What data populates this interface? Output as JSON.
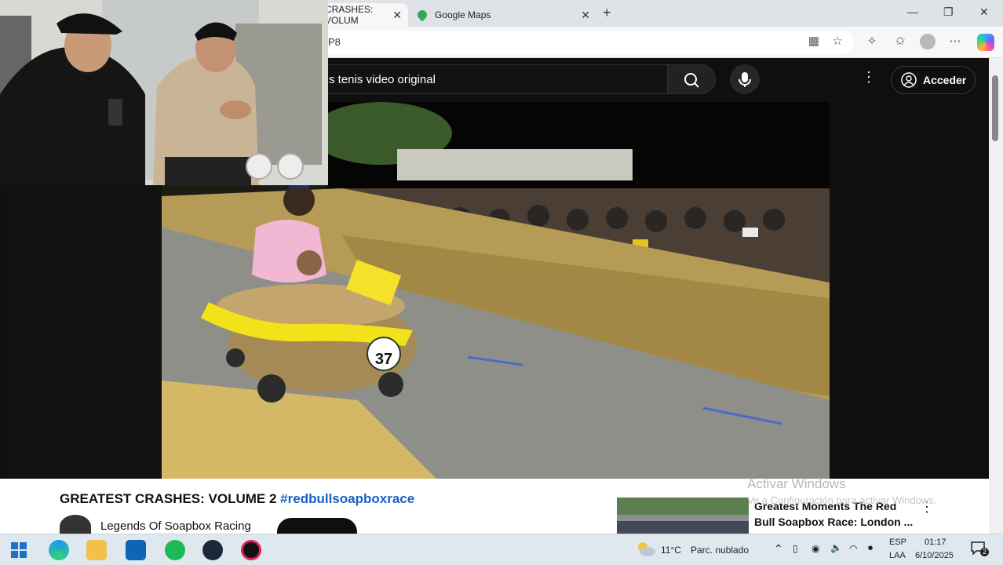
{
  "browser": {
    "tabs": [
      {
        "label": "CRASHES: VOLUM"
      },
      {
        "label": "Google Maps"
      }
    ],
    "new_tab_symbol": "+",
    "url_fragment": "P8",
    "window_controls": {
      "minimize": "—",
      "restore": "❐",
      "close": "✕"
    }
  },
  "youtube": {
    "search_query": "s tenis video original",
    "more_symbol": "⋮",
    "signin_label": "Acceder",
    "video": {
      "title_main": "GREATEST CRASHES: VOLUME 2",
      "title_hashtag": "#redbullsoapboxrace",
      "channel_name": "Legends Of Soapbox Racing",
      "kart_number": "37"
    },
    "recommendation": {
      "title": "Greatest Moments The Red Bull Soapbox Race: London ...",
      "more_symbol": "⋮"
    }
  },
  "watermark": {
    "line1": "Activar Windows",
    "line2": "Ve a Configuración para activar Windows."
  },
  "taskbar": {
    "weather_temp": "11°C",
    "weather_desc": "Parc. nublado",
    "lang_top": "ESP",
    "lang_bottom": "LAA",
    "time": "01:17",
    "date": "6/10/2025",
    "notification_count": "2"
  },
  "colors": {
    "hashtag": "#1a5fc4",
    "yt_dark": "#0f0f0f",
    "taskbar": "#dfe7ef"
  }
}
